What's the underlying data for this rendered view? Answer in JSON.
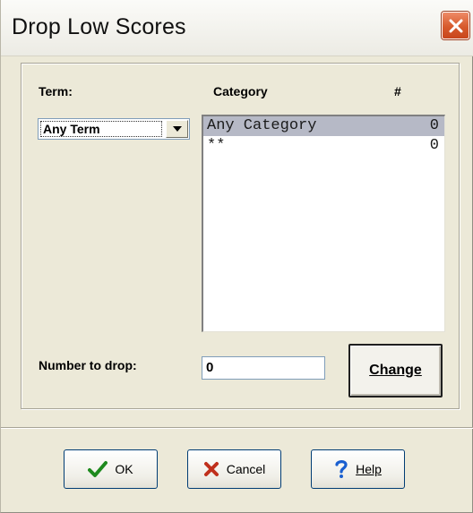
{
  "window": {
    "title": "Drop Low Scores"
  },
  "labels": {
    "term": "Term:",
    "category": "Category",
    "count": "#",
    "number_to_drop": "Number to drop:"
  },
  "term_select": {
    "value": "Any Term"
  },
  "category_list": {
    "items": [
      {
        "name": "Any Category",
        "count": "0",
        "selected": true
      },
      {
        "name": "**",
        "count": "0",
        "selected": false
      }
    ]
  },
  "number_to_drop": {
    "value": "0"
  },
  "buttons": {
    "change": "Change",
    "ok": "OK",
    "cancel": "Cancel",
    "help": "Help"
  },
  "icons": {
    "close": "close-icon",
    "ok": "checkmark-icon",
    "cancel": "x-icon",
    "help": "question-mark-icon"
  },
  "colors": {
    "close_button": "#d75a2c",
    "ok_check": "#1e8a1e",
    "cancel_x": "#c0301c",
    "help_question": "#1a5fd0",
    "selection": "#b6b9c6"
  }
}
